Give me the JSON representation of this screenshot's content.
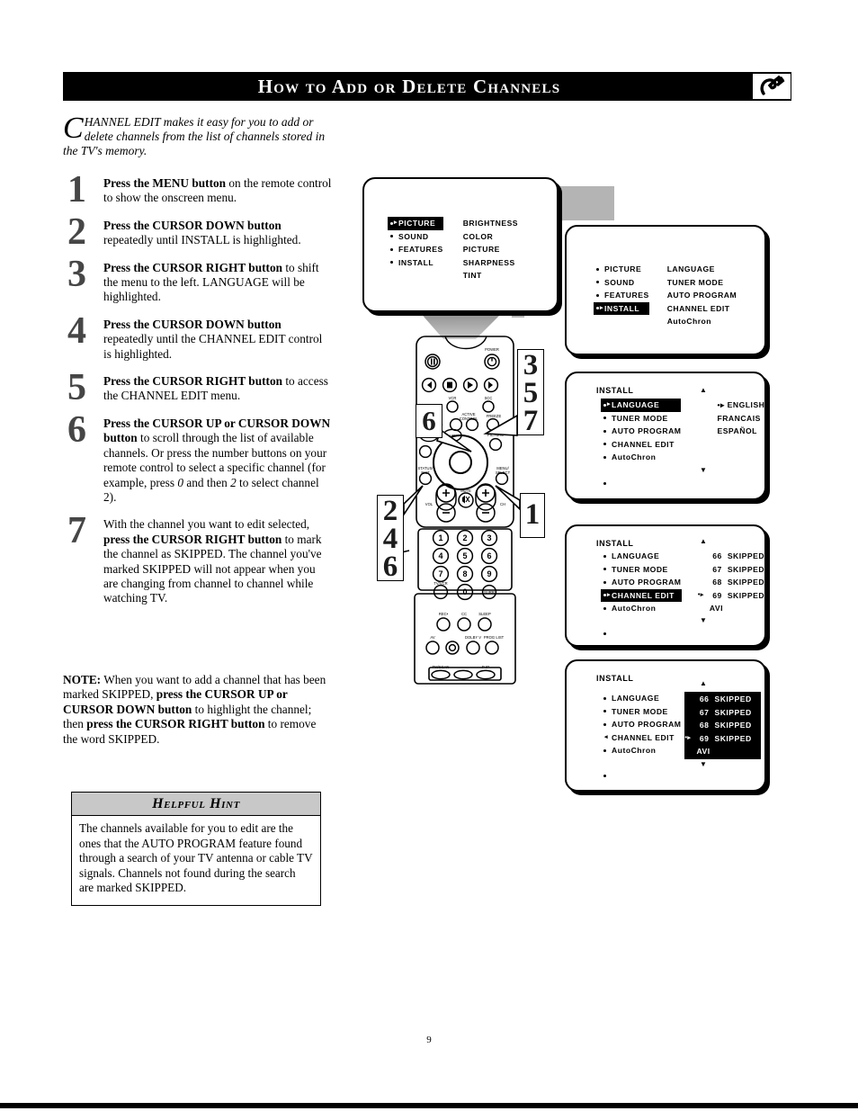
{
  "header": {
    "title": "How to Add or Delete Channels",
    "logo_icon": "hook-arrow-logo-icon"
  },
  "intro": {
    "dropcap": "C",
    "text": "HANNEL EDIT makes it easy for you to add or delete channels from the list of channels stored in the TV's memory."
  },
  "steps": [
    {
      "number": "1",
      "html": "<b>Press the MENU button</b> on the remote control to show the onscreen menu."
    },
    {
      "number": "2",
      "html": "<b>Press the CURSOR DOWN button</b> repeatedly until INSTALL is highlighted."
    },
    {
      "number": "3",
      "html": "<b>Press the CURSOR RIGHT button</b> to shift the menu to the left. LANGUAGE will be highlighted."
    },
    {
      "number": "4",
      "html": "<b>Press the CURSOR DOWN button</b> repeatedly until the CHANNEL EDIT control is highlighted."
    },
    {
      "number": "5",
      "html": "<b>Press the CURSOR RIGHT button</b> to access the CHANNEL EDIT menu."
    },
    {
      "number": "6",
      "html": "<b>Press the CURSOR UP or CURSOR DOWN button</b> to scroll through the list of available channels.  Or press the number buttons on your remote control to select a specific channel (for example, press <i>0</i> and then <i>2</i> to select channel 2)."
    },
    {
      "number": "7",
      "html": "With the channel you want to edit selected, <b>press the CURSOR RIGHT button</b> to mark the channel as SKIPPED.  The channel you've marked SKIPPED will not appear when you are changing from channel to channel while watching TV."
    }
  ],
  "note": {
    "html": "<b>NOTE:</b>  When you want to add a channel that has been marked SKIPPED, <b>press the CURSOR UP or CURSOR DOWN button</b> to highlight the channel; then <b>press the CURSOR RIGHT button</b> to remove the word SKIPPED."
  },
  "hint": {
    "heading": "Helpful Hint",
    "body": "The channels available for you to edit are the ones that the AUTO PROGRAM feature found through a search of your TV antenna or cable TV signals. Channels not found during the search are marked SKIPPED."
  },
  "tv_panels": {
    "panel_main": {
      "left_column": [
        {
          "label": "PICTURE",
          "selected": true
        },
        {
          "label": "SOUND",
          "selected": false
        },
        {
          "label": "FEATURES",
          "selected": false
        },
        {
          "label": "INSTALL",
          "selected": false
        }
      ],
      "right_column": [
        "BRIGHTNESS",
        "COLOR",
        "PICTURE",
        "SHARPNESS",
        "TINT"
      ]
    },
    "panel_install_selected": {
      "left_column": [
        {
          "label": "PICTURE",
          "selected": false
        },
        {
          "label": "SOUND",
          "selected": false
        },
        {
          "label": "FEATURES",
          "selected": false
        },
        {
          "label": "INSTALL",
          "selected": true
        }
      ],
      "right_column": [
        "LANGUAGE",
        "TUNER MODE",
        "AUTO PROGRAM",
        "CHANNEL EDIT",
        "AutoChron"
      ]
    },
    "panel_language": {
      "title": "INSTALL",
      "arrow_up": "▲",
      "arrow_down": "▼",
      "left_column": [
        {
          "label": "LANGUAGE",
          "selected": true,
          "cursor_left": true
        },
        {
          "label": "TUNER MODE",
          "selected": false
        },
        {
          "label": "AUTO PROGRAM",
          "selected": false
        },
        {
          "label": "CHANNEL EDIT",
          "selected": false
        },
        {
          "label": "AutoChron",
          "selected": false
        }
      ],
      "right_column": [
        {
          "label": "ENGLISH",
          "marked": true
        },
        {
          "label": "FRANCAIS",
          "marked": false
        },
        {
          "label": "ESPAÑOL",
          "marked": false
        }
      ]
    },
    "panel_channel_edit": {
      "title": "INSTALL",
      "arrow_up": "▲",
      "arrow_down": "▼",
      "left_column": [
        {
          "label": "LANGUAGE",
          "selected": false
        },
        {
          "label": "TUNER MODE",
          "selected": false
        },
        {
          "label": "AUTO PROGRAM",
          "selected": false
        },
        {
          "label": "CHANNEL EDIT",
          "selected": true,
          "cursor_left": true
        },
        {
          "label": "AutoChron",
          "selected": false
        }
      ],
      "channels": [
        {
          "number": "66",
          "status": "SKIPPED",
          "marked": false
        },
        {
          "number": "67",
          "status": "SKIPPED",
          "marked": false
        },
        {
          "number": "68",
          "status": "SKIPPED",
          "marked": false
        },
        {
          "number": "69",
          "status": "SKIPPED",
          "marked": true
        },
        {
          "number": "AVI",
          "status": "",
          "marked": false
        }
      ]
    },
    "panel_channel_list_active": {
      "title": "INSTALL",
      "arrow_up": "▲",
      "arrow_down": "▼",
      "left_column": [
        {
          "label": "LANGUAGE",
          "selected": false
        },
        {
          "label": "TUNER MODE",
          "selected": false
        },
        {
          "label": "AUTO PROGRAM",
          "selected": false
        },
        {
          "label": "CHANNEL EDIT",
          "selected": false,
          "cursor_left": true
        },
        {
          "label": "AutoChron",
          "selected": false
        }
      ],
      "channels": [
        {
          "number": "66",
          "status": "SKIPPED",
          "marked": false
        },
        {
          "number": "67",
          "status": "SKIPPED",
          "marked": false
        },
        {
          "number": "68",
          "status": "SKIPPED",
          "marked": false
        },
        {
          "number": "69",
          "status": "SKIPPED",
          "marked": true
        },
        {
          "number": "AVI",
          "status": "",
          "marked": false
        }
      ],
      "list_inverted": true
    }
  },
  "callouts": {
    "group_357": "3\n5\n7",
    "group_357_lines": [
      "3",
      "5",
      "7"
    ],
    "group_1": "1",
    "group_246_lines": [
      "2",
      "4",
      "6"
    ],
    "group_6": "6"
  },
  "remote": {
    "labels": {
      "power": "POWER",
      "vcr": "VCR",
      "scc": "SCC",
      "pip_ch": "PIP-CH",
      "pip_dn": "DN",
      "pip_up": "UP",
      "active_control": "ACTIVE CONTROL",
      "freeze": "FREEZE",
      "picture": "PICTURE",
      "status_exit": "STATUS/ EXIT",
      "menu_select": "MENU/ SELECT",
      "vol": "VOL",
      "mute": "MUTE",
      "ch": "CH",
      "tvvcr": "TV/VCR",
      "surr": "SURR",
      "rec": "REC•",
      "cc": "CC",
      "sleep": "SLEEP",
      "av": "AV",
      "dolby": "DOLBY V",
      "prog_list": "PROG LIST",
      "fm_scan": "FM/SCAN",
      "pip": "P-IP"
    },
    "keypad": [
      "1",
      "2",
      "3",
      "4",
      "5",
      "6",
      "7",
      "8",
      "9",
      "0"
    ]
  },
  "footer": {
    "page_number": "9"
  },
  "colors": {
    "ink": "#000000",
    "step_number": "#464646",
    "hint_header": "#c8c8c8",
    "beam": "#9a9a9a"
  }
}
